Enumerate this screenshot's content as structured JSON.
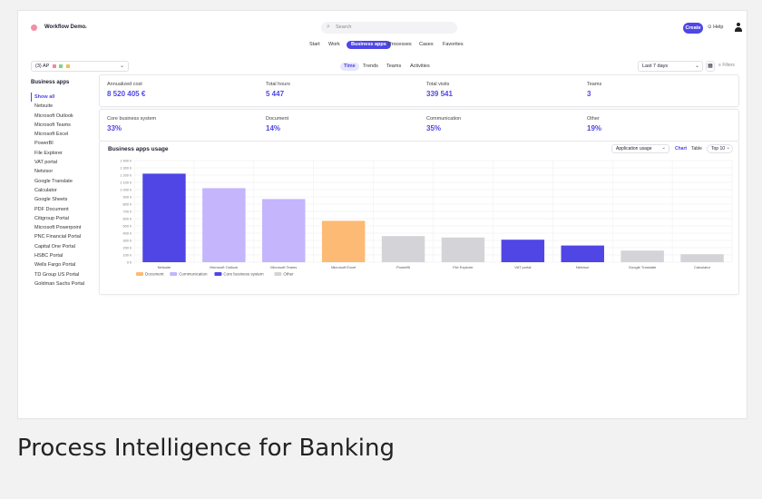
{
  "workspace": {
    "name": "Workflow Demo"
  },
  "search": {
    "placeholder": "Search"
  },
  "header": {
    "create_label": "Create",
    "help_label": "Help"
  },
  "nav": {
    "tabs": [
      "Start",
      "Work",
      "Business apps",
      "Processes",
      "Cases",
      "Favorites"
    ],
    "active": "Business apps"
  },
  "filter": {
    "ap_label": "(3) AP",
    "status_colors": [
      "#f08aa0",
      "#7cd68a",
      "#f2c14e"
    ]
  },
  "subtabs": {
    "tabs": [
      "Time",
      "Trends",
      "Teams",
      "Activities"
    ],
    "active": "Time"
  },
  "date": {
    "range": "Last 7 days"
  },
  "filters_label": "Filters",
  "sidebar": {
    "title": "Business apps",
    "items": [
      "Show all",
      "Netsuite",
      "Microsoft Outlook",
      "Microsoft Teams",
      "Microsoft Excel",
      "PowerBI",
      "File Explorer",
      "VAT portal",
      "Netvisor",
      "Google Translate",
      "Calculator",
      "Google Sheets",
      "PDF Document",
      "Citigroup Portal",
      "Microsoft Powerpoint",
      "PNC Financial Portal",
      "Capital One Portal",
      "HSBC Portal",
      "Wells Fargo Portal",
      "TD Group US Portal",
      "Goldman Sachs Portal"
    ],
    "selected": "Show all"
  },
  "kpis": [
    {
      "label": "Annualized cost",
      "value": "8 520 405 €"
    },
    {
      "label": "Total hours",
      "value": "5 447"
    },
    {
      "label": "Total visits",
      "value": "339 541"
    },
    {
      "label": "Teams",
      "value": "3"
    }
  ],
  "categories": [
    {
      "label": "Core business system",
      "value": "33%"
    },
    {
      "label": "Document",
      "value": "14%"
    },
    {
      "label": "Communication",
      "value": "35%"
    },
    {
      "label": "Other",
      "value": "19%"
    }
  ],
  "usage": {
    "title": "Business apps usage",
    "metric": "Application usage",
    "view_chart": "Chart",
    "view_table": "Table",
    "top": "Top 10"
  },
  "chart_data": {
    "type": "bar",
    "categories": [
      "Netsuite",
      "Microsoft Outlook",
      "Microsoft Teams",
      "Microsoft Excel",
      "PowerBI",
      "File Explorer",
      "VAT portal",
      "Netvisor",
      "Google Translate",
      "Calculator"
    ],
    "values": [
      1220,
      1020,
      870,
      570,
      360,
      340,
      310,
      230,
      160,
      110
    ],
    "value_groups": [
      "Core business system",
      "Communication",
      "Communication",
      "Document",
      "Other",
      "Other",
      "Core business system",
      "Core business system",
      "Other",
      "Other"
    ],
    "yticks": [
      "1 400 h",
      "1 300 h",
      "1 200 h",
      "1 100 h",
      "1 000 h",
      "900 h",
      "800 h",
      "700 h",
      "600 h",
      "500 h",
      "400 h",
      "300 h",
      "200 h",
      "100 h",
      "0 h"
    ],
    "ylim": [
      0,
      1400
    ],
    "legend": [
      {
        "name": "Document",
        "color": "#fdba74"
      },
      {
        "name": "Communication",
        "color": "#c4b5fd"
      },
      {
        "name": "Core business system",
        "color": "#4f46e5"
      },
      {
        "name": "Other",
        "color": "#d4d4d8"
      }
    ],
    "title": "Business apps usage",
    "grid": true
  },
  "caption": "Process Intelligence for Banking"
}
